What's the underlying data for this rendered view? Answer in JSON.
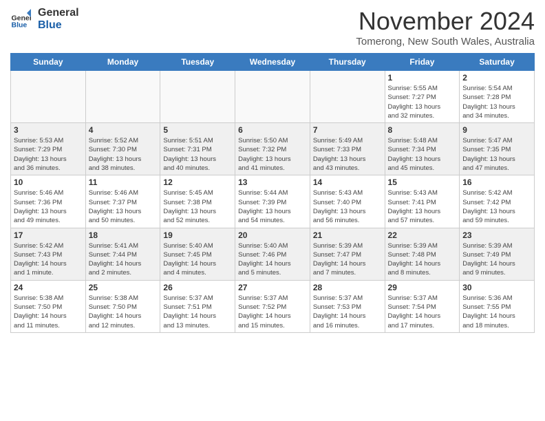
{
  "header": {
    "logo_line1": "General",
    "logo_line2": "Blue",
    "month_title": "November 2024",
    "location": "Tomerong, New South Wales, Australia"
  },
  "weekdays": [
    "Sunday",
    "Monday",
    "Tuesday",
    "Wednesday",
    "Thursday",
    "Friday",
    "Saturday"
  ],
  "weeks": [
    [
      {
        "day": "",
        "info": "",
        "empty": true
      },
      {
        "day": "",
        "info": "",
        "empty": true
      },
      {
        "day": "",
        "info": "",
        "empty": true
      },
      {
        "day": "",
        "info": "",
        "empty": true
      },
      {
        "day": "",
        "info": "",
        "empty": true
      },
      {
        "day": "1",
        "info": "Sunrise: 5:55 AM\nSunset: 7:27 PM\nDaylight: 13 hours\nand 32 minutes."
      },
      {
        "day": "2",
        "info": "Sunrise: 5:54 AM\nSunset: 7:28 PM\nDaylight: 13 hours\nand 34 minutes."
      }
    ],
    [
      {
        "day": "3",
        "info": "Sunrise: 5:53 AM\nSunset: 7:29 PM\nDaylight: 13 hours\nand 36 minutes."
      },
      {
        "day": "4",
        "info": "Sunrise: 5:52 AM\nSunset: 7:30 PM\nDaylight: 13 hours\nand 38 minutes."
      },
      {
        "day": "5",
        "info": "Sunrise: 5:51 AM\nSunset: 7:31 PM\nDaylight: 13 hours\nand 40 minutes."
      },
      {
        "day": "6",
        "info": "Sunrise: 5:50 AM\nSunset: 7:32 PM\nDaylight: 13 hours\nand 41 minutes."
      },
      {
        "day": "7",
        "info": "Sunrise: 5:49 AM\nSunset: 7:33 PM\nDaylight: 13 hours\nand 43 minutes."
      },
      {
        "day": "8",
        "info": "Sunrise: 5:48 AM\nSunset: 7:34 PM\nDaylight: 13 hours\nand 45 minutes."
      },
      {
        "day": "9",
        "info": "Sunrise: 5:47 AM\nSunset: 7:35 PM\nDaylight: 13 hours\nand 47 minutes."
      }
    ],
    [
      {
        "day": "10",
        "info": "Sunrise: 5:46 AM\nSunset: 7:36 PM\nDaylight: 13 hours\nand 49 minutes."
      },
      {
        "day": "11",
        "info": "Sunrise: 5:46 AM\nSunset: 7:37 PM\nDaylight: 13 hours\nand 50 minutes."
      },
      {
        "day": "12",
        "info": "Sunrise: 5:45 AM\nSunset: 7:38 PM\nDaylight: 13 hours\nand 52 minutes."
      },
      {
        "day": "13",
        "info": "Sunrise: 5:44 AM\nSunset: 7:39 PM\nDaylight: 13 hours\nand 54 minutes."
      },
      {
        "day": "14",
        "info": "Sunrise: 5:43 AM\nSunset: 7:40 PM\nDaylight: 13 hours\nand 56 minutes."
      },
      {
        "day": "15",
        "info": "Sunrise: 5:43 AM\nSunset: 7:41 PM\nDaylight: 13 hours\nand 57 minutes."
      },
      {
        "day": "16",
        "info": "Sunrise: 5:42 AM\nSunset: 7:42 PM\nDaylight: 13 hours\nand 59 minutes."
      }
    ],
    [
      {
        "day": "17",
        "info": "Sunrise: 5:42 AM\nSunset: 7:43 PM\nDaylight: 14 hours\nand 1 minute."
      },
      {
        "day": "18",
        "info": "Sunrise: 5:41 AM\nSunset: 7:44 PM\nDaylight: 14 hours\nand 2 minutes."
      },
      {
        "day": "19",
        "info": "Sunrise: 5:40 AM\nSunset: 7:45 PM\nDaylight: 14 hours\nand 4 minutes."
      },
      {
        "day": "20",
        "info": "Sunrise: 5:40 AM\nSunset: 7:46 PM\nDaylight: 14 hours\nand 5 minutes."
      },
      {
        "day": "21",
        "info": "Sunrise: 5:39 AM\nSunset: 7:47 PM\nDaylight: 14 hours\nand 7 minutes."
      },
      {
        "day": "22",
        "info": "Sunrise: 5:39 AM\nSunset: 7:48 PM\nDaylight: 14 hours\nand 8 minutes."
      },
      {
        "day": "23",
        "info": "Sunrise: 5:39 AM\nSunset: 7:49 PM\nDaylight: 14 hours\nand 9 minutes."
      }
    ],
    [
      {
        "day": "24",
        "info": "Sunrise: 5:38 AM\nSunset: 7:50 PM\nDaylight: 14 hours\nand 11 minutes."
      },
      {
        "day": "25",
        "info": "Sunrise: 5:38 AM\nSunset: 7:50 PM\nDaylight: 14 hours\nand 12 minutes."
      },
      {
        "day": "26",
        "info": "Sunrise: 5:37 AM\nSunset: 7:51 PM\nDaylight: 14 hours\nand 13 minutes."
      },
      {
        "day": "27",
        "info": "Sunrise: 5:37 AM\nSunset: 7:52 PM\nDaylight: 14 hours\nand 15 minutes."
      },
      {
        "day": "28",
        "info": "Sunrise: 5:37 AM\nSunset: 7:53 PM\nDaylight: 14 hours\nand 16 minutes."
      },
      {
        "day": "29",
        "info": "Sunrise: 5:37 AM\nSunset: 7:54 PM\nDaylight: 14 hours\nand 17 minutes."
      },
      {
        "day": "30",
        "info": "Sunrise: 5:36 AM\nSunset: 7:55 PM\nDaylight: 14 hours\nand 18 minutes."
      }
    ]
  ]
}
